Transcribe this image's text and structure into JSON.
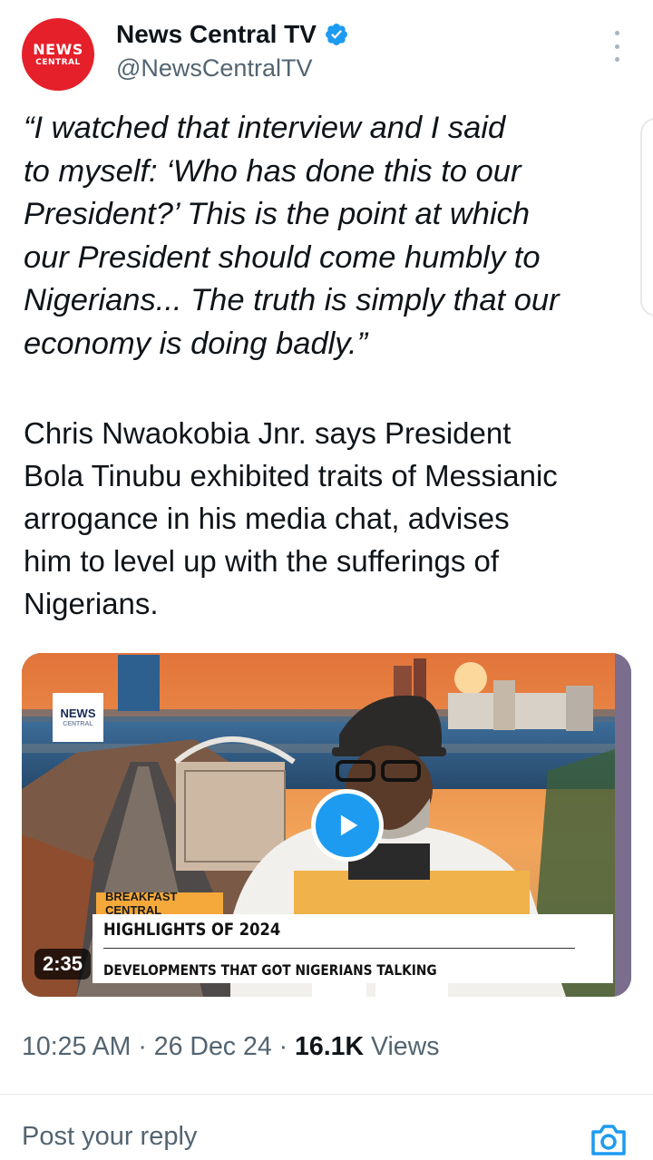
{
  "author": {
    "name": "News Central TV",
    "handle": "@NewsCentralTV",
    "avatar_text": [
      "NEWS",
      "CENTRAL"
    ],
    "verified": true,
    "avatar_color": "#e5202a"
  },
  "tweet": {
    "quote": "“I watched that interview and I said\nto myself: ‘Who has done this to our\nPresident?’ This is the point at which\nour President should come humbly to\nNigerians... The truth is simply that our\neconomy is doing badly.”",
    "body": "Chris Nwaokobia Jnr. says President\nBola Tinubu exhibited traits of Messianic\narrogance in his media chat, advises\nhim to level up with the sufferings of\nNigerians."
  },
  "media": {
    "duration": "2:35",
    "logo_text": [
      "NEWS",
      "CENTRAL"
    ],
    "lower_third": {
      "tag": "BREAKFAST CENTRAL",
      "title": "HIGHLIGHTS OF 2024",
      "subtitle": "DEVELOPMENTS THAT GOT NIGERIANS TALKING"
    }
  },
  "meta": {
    "time": "10:25 AM",
    "separator": " · ",
    "date": "26 Dec 24",
    "views_count": "16.1K",
    "views_label": " Views"
  },
  "reply": {
    "placeholder": "Post your reply"
  },
  "colors": {
    "accent": "#1d9bf0",
    "text_secondary": "#536471",
    "text_primary": "#0f1419"
  },
  "icons": [
    "verified-badge-icon",
    "more-options-icon",
    "play-icon",
    "camera-icon"
  ]
}
